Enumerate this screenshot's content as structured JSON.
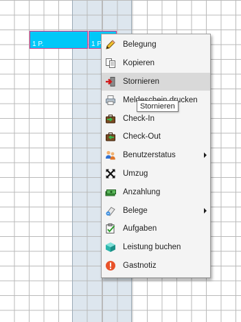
{
  "bookings": [
    {
      "label": "1 P."
    },
    {
      "label": "1 P."
    }
  ],
  "context_menu": {
    "items": [
      {
        "label": "Belegung",
        "icon": "pencil-icon"
      },
      {
        "label": "Kopieren",
        "icon": "copy-icon"
      },
      {
        "label": "Stornieren",
        "icon": "cancel-exit-icon"
      },
      {
        "label": "Meldeschein drucken",
        "icon": "printer-icon"
      },
      {
        "label": "Check-In",
        "icon": "suitcase-in-icon"
      },
      {
        "label": "Check-Out",
        "icon": "suitcase-out-icon"
      },
      {
        "label": "Benutzerstatus",
        "icon": "users-icon",
        "submenu": true
      },
      {
        "label": "Umzug",
        "icon": "move-arrows-icon"
      },
      {
        "label": "Anzahlung",
        "icon": "money-icon"
      },
      {
        "label": "Belege",
        "icon": "receipt-icon",
        "submenu": true
      },
      {
        "label": "Aufgaben",
        "icon": "task-checklist-icon"
      },
      {
        "label": "Leistung buchen",
        "icon": "cube-icon"
      },
      {
        "label": "Gastnotiz",
        "icon": "alert-note-icon"
      }
    ],
    "hovered_item": "Stornieren"
  },
  "tooltip": {
    "text": "Stornieren"
  },
  "colors": {
    "booking_fill": "#00c8f8",
    "booking_border": "#d0318a",
    "column_highlight": "#dde6ee",
    "menu_hover": "#d9d9d9"
  }
}
